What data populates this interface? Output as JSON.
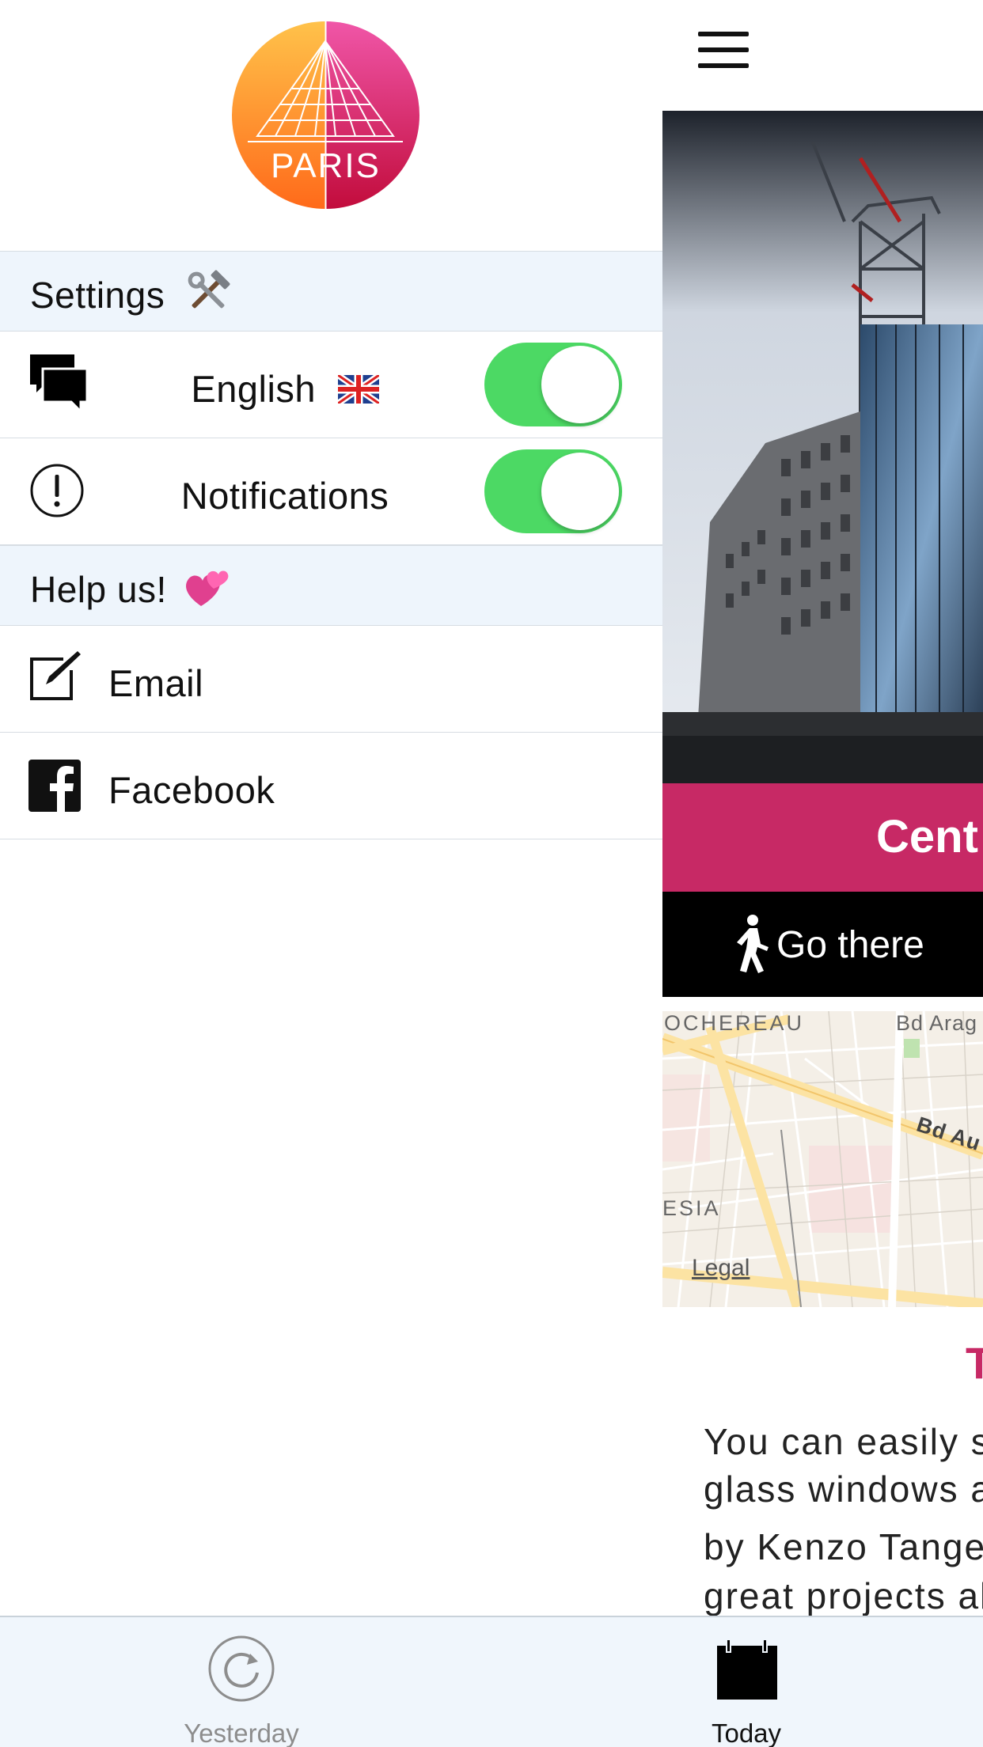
{
  "drawer": {
    "logo": {
      "text": "PARIS",
      "icon": "louvre-pyramid-logo"
    },
    "settings_header": {
      "label": "Settings",
      "emoji": "hammer-and-wrench-icon"
    },
    "rows": [
      {
        "label": "English",
        "icon": "speech-bubbles-icon",
        "flag": "uk-flag-icon",
        "toggle_on": true
      },
      {
        "label": "Notifications",
        "icon": "exclamation-circle-icon",
        "toggle_on": true
      }
    ],
    "help_header": {
      "label": "Help us!",
      "emoji": "two-hearts-icon"
    },
    "links": [
      {
        "label": "Email",
        "icon": "compose-icon"
      },
      {
        "label": "Facebook",
        "icon": "facebook-icon"
      }
    ]
  },
  "main": {
    "menu_icon": "hamburger-icon",
    "title": "Cent",
    "go_there": "Go there",
    "map": {
      "labels": [
        "OCHEREAU",
        "Bd Arag",
        "Bd Au",
        "ESIA"
      ],
      "legal": "Legal"
    },
    "section_title": "T",
    "body_lines": [
      "You can easily se",
      "glass windows a",
      "by Kenzo Tange",
      "great projects all"
    ]
  },
  "tabbar": {
    "tabs": [
      {
        "label": "Yesterday",
        "icon": "replay-circle-icon",
        "active": false
      },
      {
        "label": "Today",
        "icon": "calendar-icon",
        "active": true
      }
    ]
  },
  "colors": {
    "accent": "#c72965",
    "toggle_on": "#4cd964",
    "header_bg": "#eef5fc",
    "tabbar_bg": "#f0f6fc"
  }
}
